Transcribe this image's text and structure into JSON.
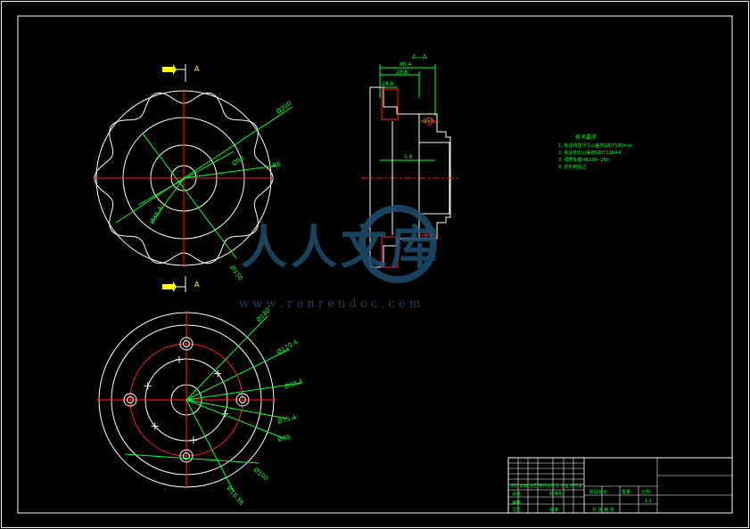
{
  "colors": {
    "background": "#000000",
    "outline": "#ffffff",
    "centerline": "#ff2020",
    "dimension": "#00ff33",
    "arrow_marker": "#ffff00",
    "pitch_circle": "#ff2020",
    "watermark": "#1e4e6e"
  },
  "front_view": {
    "section_marker_top": "A",
    "section_marker_bottom": "A",
    "dim_labels": [
      "Ø200",
      "Ø88",
      "R8",
      "Ø150",
      "Ø38.4"
    ]
  },
  "bottom_view": {
    "dim_labels": [
      "Ø180",
      "Ø120.4",
      "Ø80.4",
      "Ø75.4",
      "Ø48",
      "Ø100",
      "Ø18.56"
    ]
  },
  "section_view": {
    "title": "A—A",
    "dim_labels": [
      "80.4",
      "20.8",
      "28.8",
      "5.8",
      "Ø10"
    ]
  },
  "notes": {
    "title": "技术要求",
    "lines": [
      "1. 未注线性尺寸公差按GB/T1804-m",
      "2. 未注形位公差按GB/T1184-K",
      "3. 调质处理HB220~250",
      "4. 去毛刺锐边"
    ]
  },
  "title_block": {
    "row_text": "标记 处数 分区 更改文件号 签名 年月日",
    "designer_label": "设计",
    "reviewer_label": "审核",
    "process_label": "工艺",
    "std_label": "标准化",
    "approve_label": "批准",
    "stage_label": "阶段标记",
    "weight_label": "重量",
    "scale_label": "比例",
    "scale_value": "1:1",
    "sheet_label": "共 张 第 张"
  },
  "watermark": {
    "text": "人人文库",
    "url": "w w w . r e n r e n d o c . c o m"
  }
}
